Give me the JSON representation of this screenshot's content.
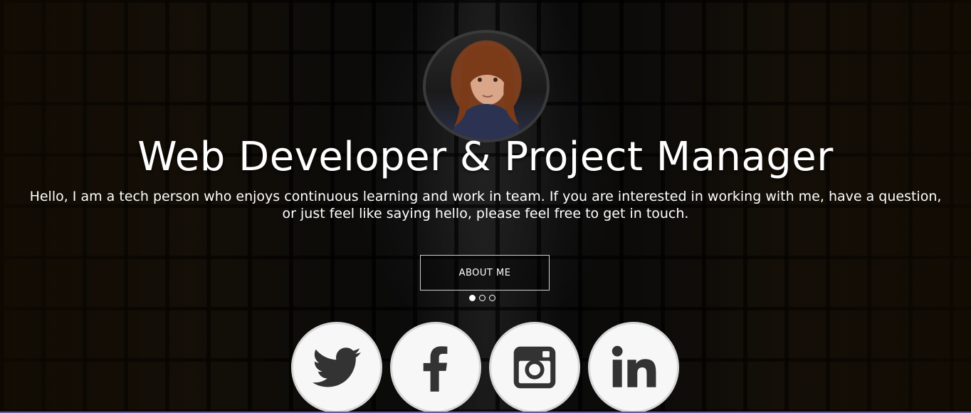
{
  "hero": {
    "title": "Web Developer & Project Manager",
    "intro_line1": "Hello, I am a tech person who enjoys continuous learning and work in team. If you are interested in working with me, have a question,",
    "intro_line2": "or just feel like saying hello, please feel free to get in touch.",
    "about_button": "ABOUT ME"
  },
  "carousel": {
    "slides": 3,
    "active_index": 0
  },
  "social": {
    "icons": [
      "twitter-icon",
      "facebook-icon",
      "instagram-icon",
      "linkedin-icon"
    ]
  },
  "colors": {
    "text": "#ffffff",
    "icon": "#333333",
    "icon_bg": "#f7f7f7",
    "bottom_accent": "#6b5a9a"
  }
}
